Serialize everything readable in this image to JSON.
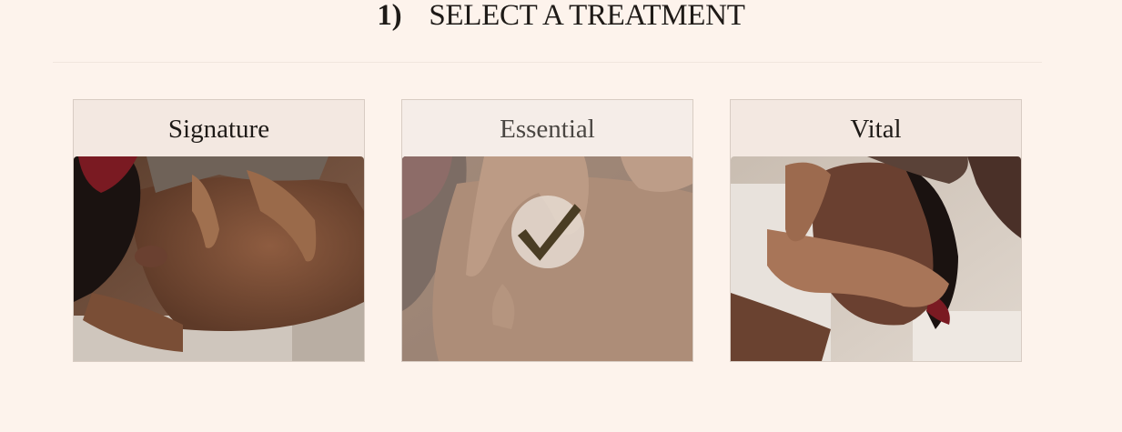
{
  "section": {
    "step_number": "1)",
    "title": "SELECT A TREATMENT"
  },
  "treatments": [
    {
      "name": "Signature",
      "image": "back-massage-photo",
      "selected": false
    },
    {
      "name": "Essential",
      "image": "shoulder-massage-photo",
      "selected": true
    },
    {
      "name": "Vital",
      "image": "facial-massage-photo",
      "selected": false
    }
  ],
  "icons": {
    "selected_indicator": "checkmark-icon"
  },
  "colors": {
    "background": "#fdf3ec",
    "card_header": "#f3e8e1",
    "card_border": "#d8ccc3",
    "check_mark": "#4a3d24"
  }
}
